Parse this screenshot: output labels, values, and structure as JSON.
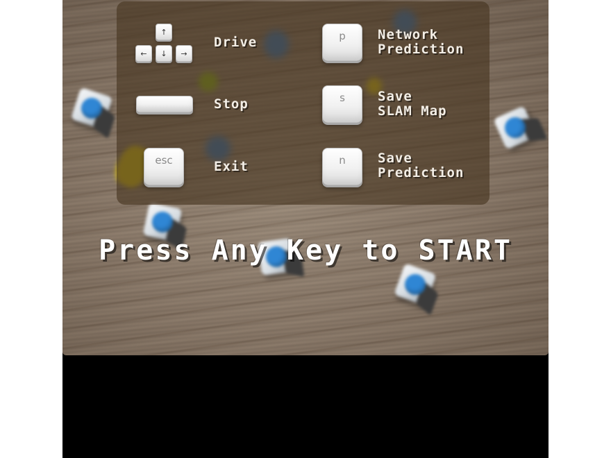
{
  "controls": {
    "drive": {
      "keys": [
        "↑",
        "←",
        "↓",
        "→"
      ],
      "label": "Drive"
    },
    "stop": {
      "key": "",
      "label": "Stop"
    },
    "exit": {
      "key": "esc",
      "label": "Exit"
    },
    "network_prediction": {
      "key": "p",
      "label": "Network\nPrediction"
    },
    "save_slam_map": {
      "key": "s",
      "label": "Save\nSLAM Map"
    },
    "save_prediction": {
      "key": "n",
      "label": "Save\nPrediction"
    }
  },
  "start_prompt": "Press Any Key to START",
  "colors": {
    "panel": "#46341e",
    "dice_face": "#2f86d4",
    "letterbox": "#000000"
  }
}
